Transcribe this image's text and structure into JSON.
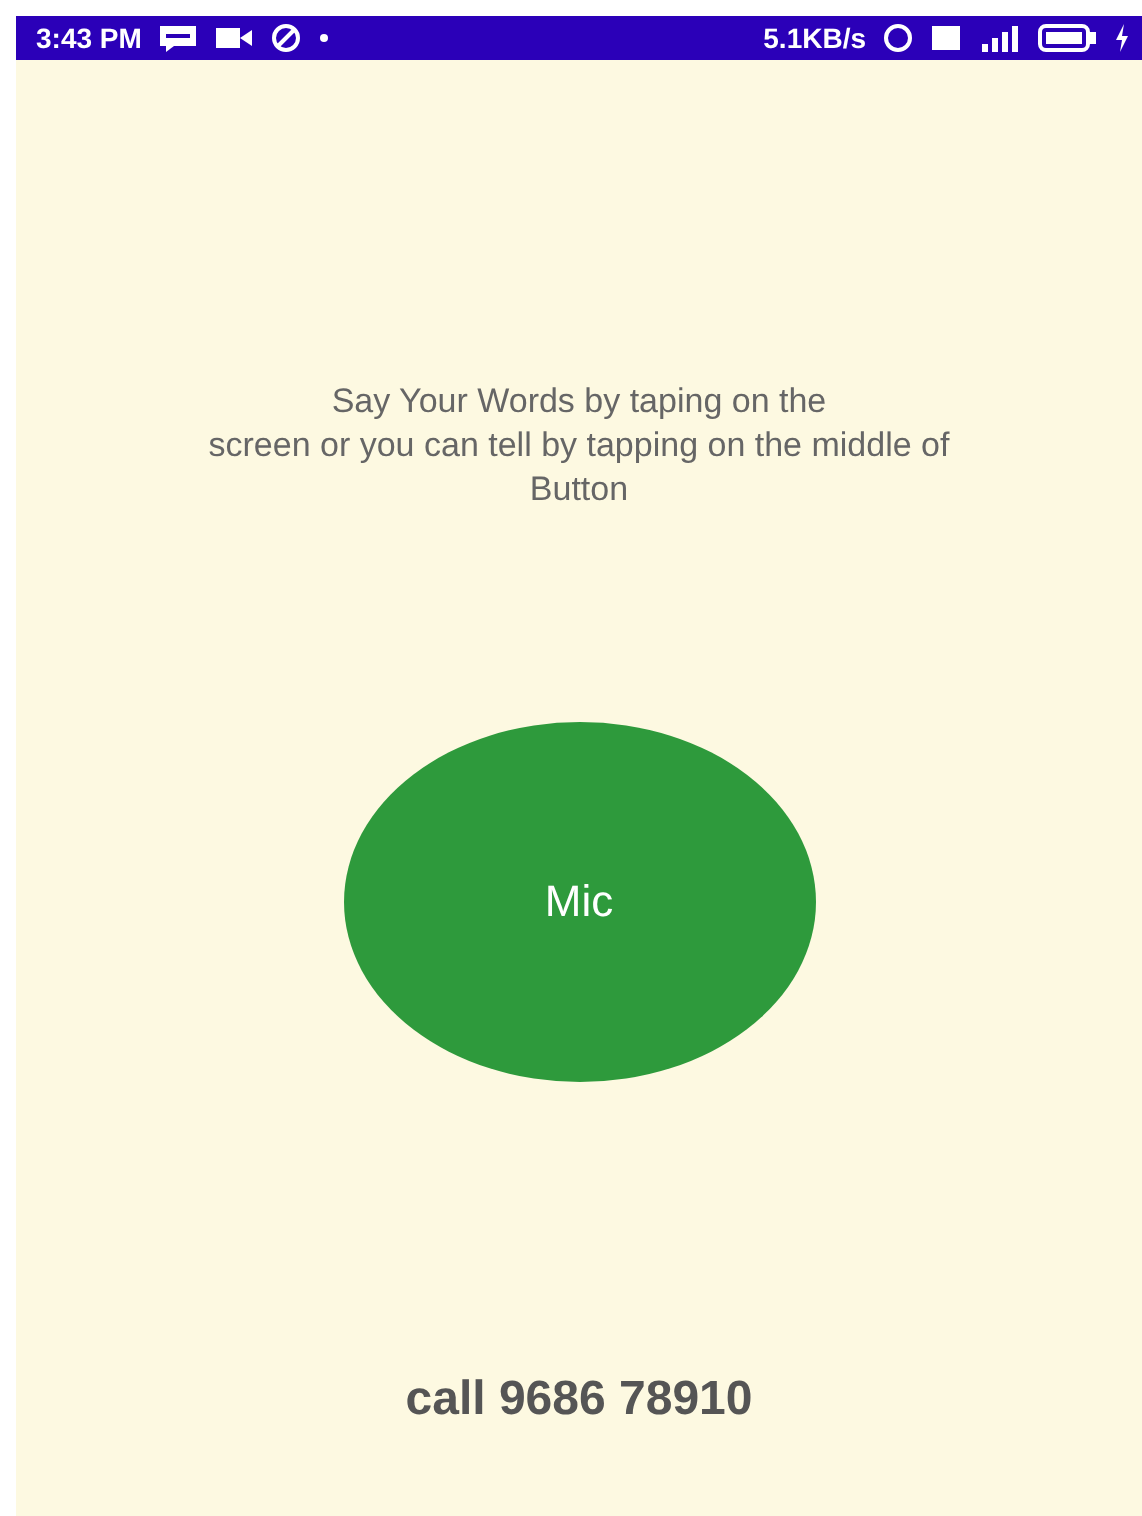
{
  "status_bar": {
    "time": "3:43 PM",
    "speed": "5.1KB/s"
  },
  "instructions": [
    "Say Your Words by taping on the",
    "screen or you can tell by tapping on the middle of",
    "Button"
  ],
  "mic_button": {
    "label": "Mic"
  },
  "call_text": "call 9686 78910"
}
